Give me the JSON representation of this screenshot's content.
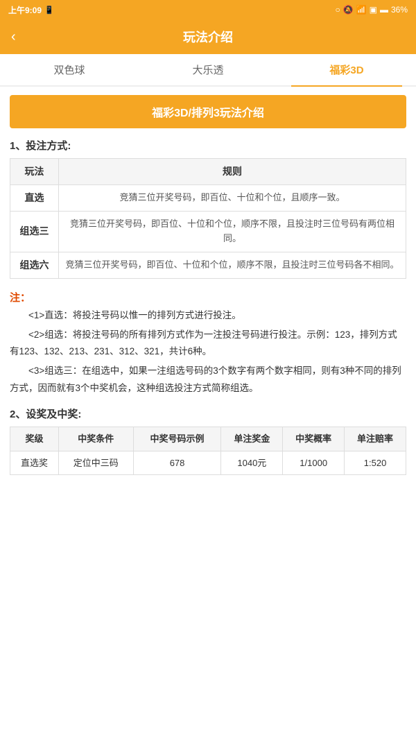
{
  "statusBar": {
    "time": "上午9:09",
    "battery": "36%"
  },
  "navBar": {
    "backIcon": "‹",
    "title": "玩法介绍"
  },
  "tabs": [
    {
      "id": "tab1",
      "label": "双色球",
      "active": false
    },
    {
      "id": "tab2",
      "label": "大乐透",
      "active": false
    },
    {
      "id": "tab3",
      "label": "福彩3D",
      "active": true
    }
  ],
  "banner": "福彩3D/排列3玩法介绍",
  "section1": {
    "heading": "1、投注方式:",
    "tableHeaders": [
      "玩法",
      "规则"
    ],
    "tableRows": [
      {
        "name": "直选",
        "rule": "竞猜三位开奖号码，即百位、十位和个位，且顺序一致。"
      },
      {
        "name": "组选三",
        "rule": "竞猜三位开奖号码，即百位、十位和个位，顺序不限，且投注时三位号码有两位相同。"
      },
      {
        "name": "组选六",
        "rule": "竞猜三位开奖号码，即百位、十位和个位，顺序不限，且投注时三位号码各不相同。"
      }
    ]
  },
  "notes": {
    "label": "注：",
    "items": [
      "<1>直选：将投注号码以惟一的排列方式进行投注。",
      "<2>组选：将投注号码的所有排列方式作为一注投注号码进行投注。示例：123，排列方式有123、132、213、231、312、321，共计6种。",
      "<3>组选三：在组选中，如果一注组选号码的3个数字有两个数字相同，则有3种不同的排列方式，因而就有3个中奖机会，这种组选投注方式简称组选。"
    ]
  },
  "section2": {
    "heading": "2、设奖及中奖:",
    "tableHeaders": [
      "奖级",
      "中奖条件",
      "中奖号码示例",
      "单注奖金",
      "中奖概率",
      "单注赔率"
    ],
    "tableRows": [
      {
        "level": "直选奖",
        "condition": "定位中三码",
        "example": "678",
        "prize": "1040元",
        "odds": "1/1000",
        "ratio": "1:520"
      }
    ]
  }
}
